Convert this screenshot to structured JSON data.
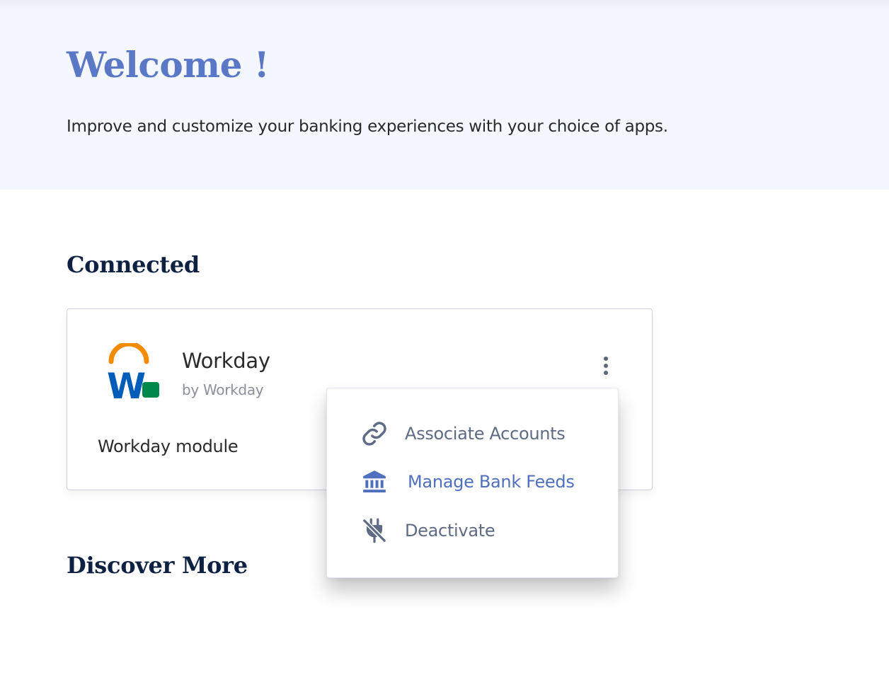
{
  "hero": {
    "title": "Welcome !",
    "subtitle": "Improve and customize your banking experiences with your choice of apps."
  },
  "sections": {
    "connected": "Connected",
    "discover": "Discover More"
  },
  "app": {
    "name": "Workday",
    "vendor": "by Workday",
    "description": "Workday module",
    "logo": "workday-logo",
    "more_icon": "more-vertical-icon"
  },
  "menu": {
    "items": [
      {
        "label": "Associate Accounts",
        "icon": "link-icon"
      },
      {
        "label": "Manage Bank Feeds",
        "icon": "bank-icon"
      },
      {
        "label": "Deactivate",
        "icon": "unplug-icon"
      }
    ]
  },
  "colors": {
    "hero_background": "#f4f7fe",
    "welcome_title": "#5b78c7",
    "section_title": "#0f2142",
    "menu_text": "#5f6b85",
    "menu_active": "#4f6fbf",
    "logo_orange": "#f38b00",
    "logo_blue": "#005cb9",
    "logo_green": "#00884a"
  }
}
